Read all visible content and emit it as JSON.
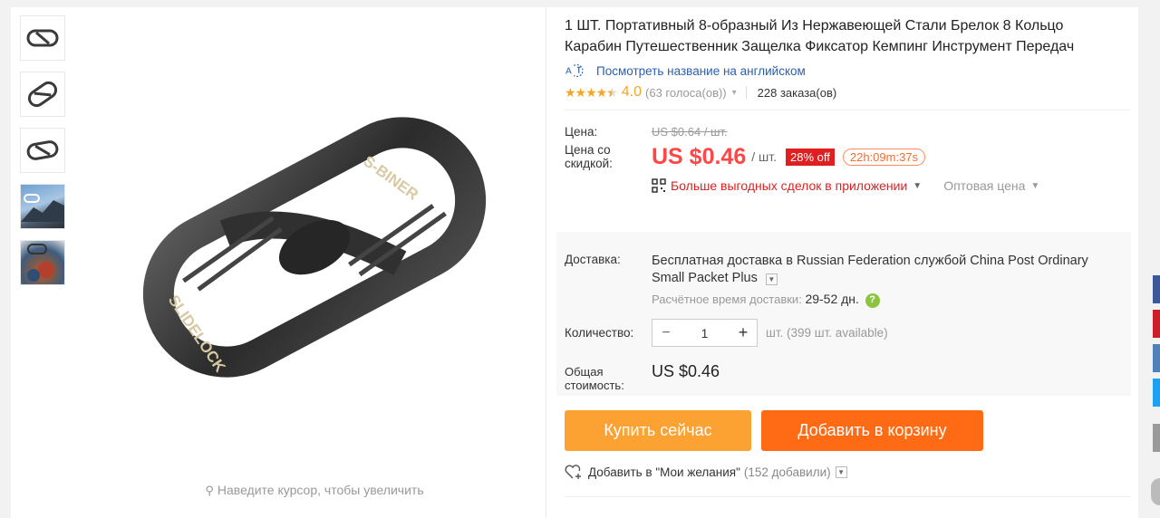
{
  "thumbnails": [
    "thumb-1",
    "thumb-2",
    "thumb-3",
    "thumb-4",
    "thumb-5"
  ],
  "product": {
    "title": "1 ШТ. Портативный 8-образный Из Нержавеющей Стали Брелок 8 Кольцо Карабин Путешественник Защелка Фиксатор Кемпинг Инструмент Передач",
    "image_text_1": "S-BINER",
    "image_text_2": "SLIDELOCK",
    "zoom_hint": "Наведите курсор, чтобы увеличить"
  },
  "translate": {
    "label": "Посмотреть название на английском"
  },
  "rating": {
    "stars": "★★★★★",
    "value": "4.0",
    "votes": "(63 голоса(ов))",
    "orders": "228 заказа(ов)"
  },
  "price": {
    "label": "Цена:",
    "old": "US $0.64 / шт.",
    "discount_label": "Цена со скидкой:",
    "new": "US $0.46",
    "per": "/ шт.",
    "off_badge": "28% off",
    "timer": "22h:09m:37s",
    "app_deals": "Больше выгодных сделок в приложении",
    "wholesale": "Оптовая цена"
  },
  "shipping": {
    "label": "Доставка:",
    "text_prefix": "Бесплатная доставка в",
    "text_rest": "Russian Federation службой China Post Ordinary Small Packet Plus",
    "eta_label": "Расчётное время доставки:",
    "eta_value": "29-52 дн."
  },
  "quantity": {
    "label": "Количество:",
    "value": "1",
    "minus": "−",
    "plus": "+",
    "available": "шт. (399 шт. available)"
  },
  "total": {
    "label": "Общая стоимость:",
    "value": "US $0.46"
  },
  "buttons": {
    "buy_now": "Купить сейчас",
    "add_to_cart": "Добавить в корзину"
  },
  "wishlist": {
    "label": "Добавить в \"Мои желания\"",
    "count": "(152 добавили)"
  },
  "colors": {
    "price_red": "#ff4747",
    "buy_orange": "#fca232",
    "cart_orange": "#ff6a14",
    "link_blue": "#2a5fb0",
    "star_orange": "#f5a623"
  }
}
